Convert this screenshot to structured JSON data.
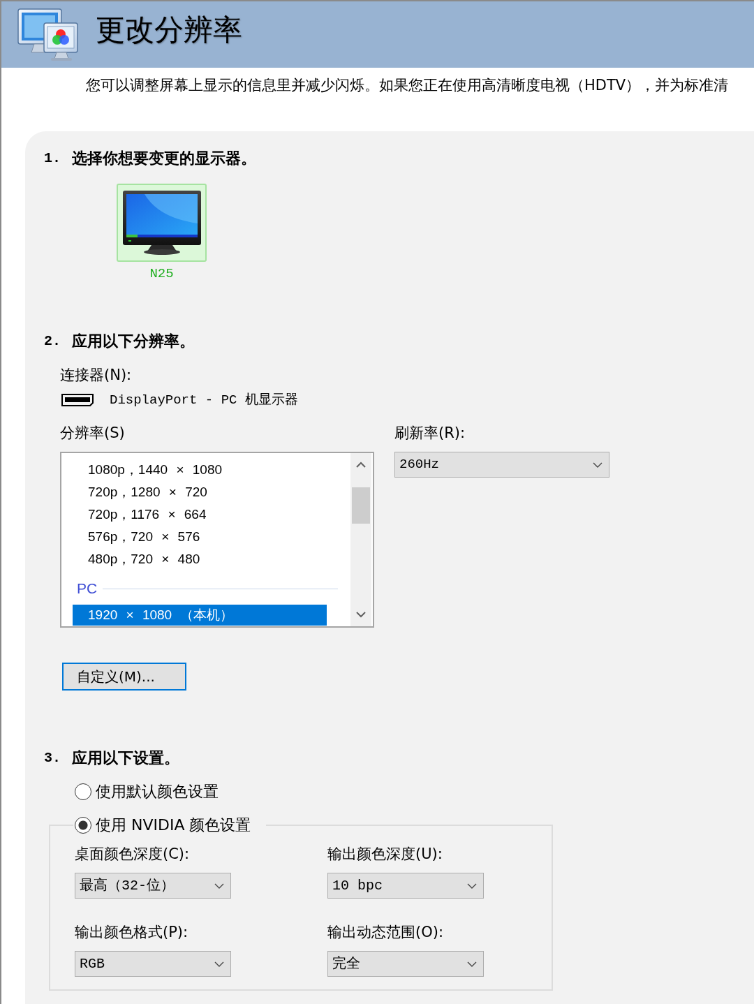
{
  "header": {
    "title": "更改分辨率",
    "description": "您可以调整屏幕上显示的信息里并减少闪烁。如果您正在使用高清晰度电视（HDTV），并为标准清"
  },
  "step_1": {
    "number": "1.",
    "heading": "选择你想要变更的显示器。",
    "displays": [
      {
        "name": "N25",
        "selected": true
      }
    ]
  },
  "step_2": {
    "number": "2.",
    "heading": "应用以下分辨率。",
    "connector_label": "连接器(N):",
    "connector": "DisplayPort - PC 机显示器",
    "resolution_label": "分辨率(S)",
    "resolutions": [
      {
        "kind": "item",
        "label": "1080p，1440 × 1080",
        "selected": false
      },
      {
        "kind": "item",
        "label": "720p，1280 × 720",
        "selected": false
      },
      {
        "kind": "item",
        "label": "720p，1176 × 664",
        "selected": false
      },
      {
        "kind": "item",
        "label": "576p，720 × 576",
        "selected": false
      },
      {
        "kind": "item",
        "label": "480p，720 × 480",
        "selected": false
      },
      {
        "kind": "group",
        "label": "PC"
      },
      {
        "kind": "item",
        "label": "1920 × 1080 （本机）",
        "selected": true
      }
    ],
    "refresh_label": "刷新率(R):",
    "refresh_rate": "260Hz",
    "custom_button": "自定义(M)..."
  },
  "step_3": {
    "number": "3.",
    "heading": "应用以下设置。",
    "color_options": [
      {
        "label": "使用默认颜色设置",
        "selected": false
      },
      {
        "label": "使用 NVIDIA 颜色设置",
        "selected": true,
        "settings": [
          {
            "label": "桌面颜色深度(C):",
            "value": "最高（32-位）"
          },
          {
            "label": "输出颜色深度(U):",
            "value": "10 bpc"
          },
          {
            "label": "输出颜色格式(P):",
            "value": "RGB"
          },
          {
            "label": "输出动态范围(O):",
            "value": "完全"
          }
        ]
      }
    ]
  }
}
